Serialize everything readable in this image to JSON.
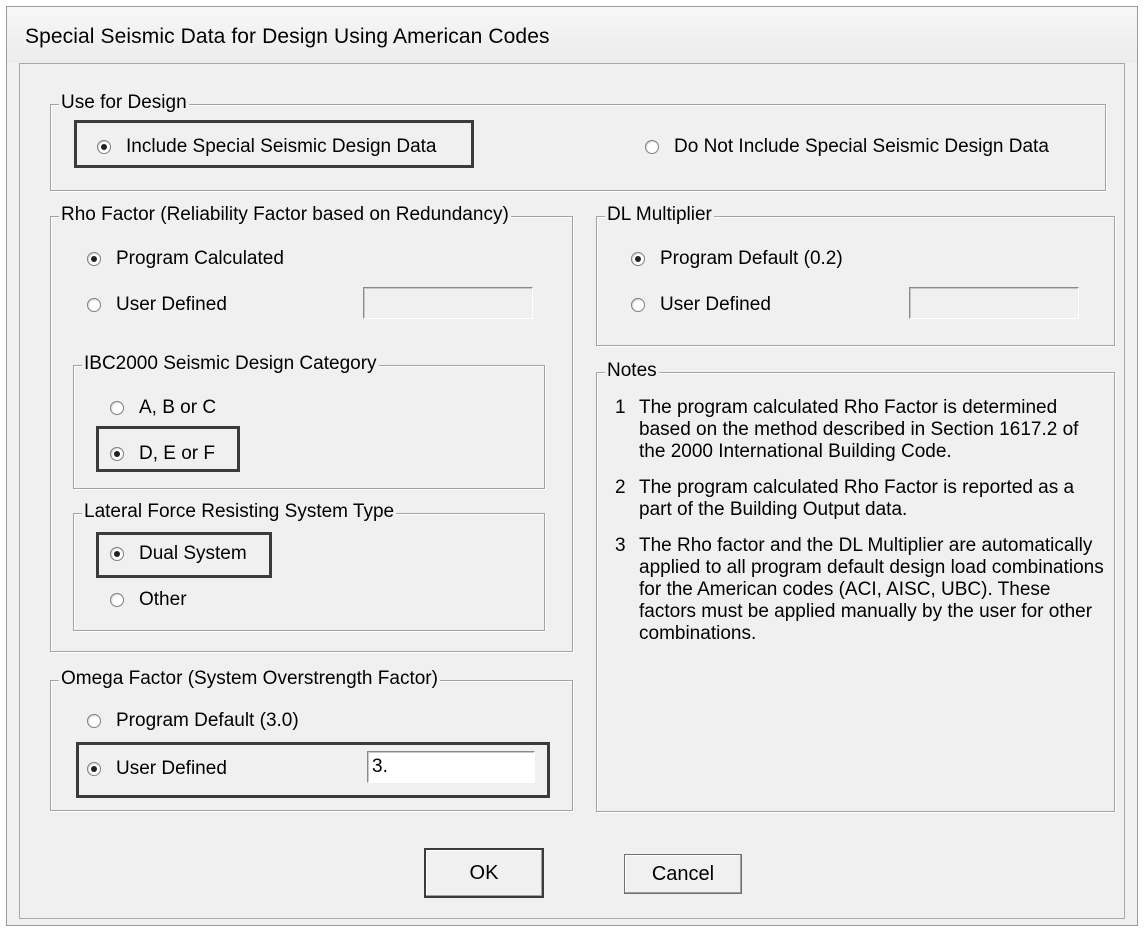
{
  "window": {
    "title": "Special Seismic Data for Design Using American Codes"
  },
  "use_for_design": {
    "legend": "Use for Design",
    "include_label": "Include Special Seismic Design Data",
    "exclude_label": "Do Not Include Special Seismic Design Data",
    "selected": "include"
  },
  "rho_factor": {
    "legend": "Rho Factor (Reliability Factor based on Redundancy)",
    "program_label": "Program Calculated",
    "user_label": "User Defined",
    "user_value": "",
    "selected": "program"
  },
  "ibc_category": {
    "legend": "IBC2000 Seismic Design Category",
    "abc_label": "A, B or C",
    "def_label": "D, E or F",
    "selected": "def"
  },
  "lateral_system": {
    "legend": "Lateral Force Resisting System Type",
    "dual_label": "Dual System",
    "other_label": "Other",
    "selected": "dual"
  },
  "omega_factor": {
    "legend": "Omega Factor (System Overstrength Factor)",
    "default_label": "Program Default (3.0)",
    "user_label": "User Defined",
    "user_value": "3.",
    "selected": "user"
  },
  "dl_multiplier": {
    "legend": "DL Multiplier",
    "default_label": "Program Default (0.2)",
    "user_label": "User Defined",
    "user_value": "",
    "selected": "default"
  },
  "notes": {
    "legend": "Notes",
    "items": [
      {
        "num": "1",
        "text": "The program calculated Rho Factor is determined based on the method described in Section 1617.2 of the 2000 International Building Code."
      },
      {
        "num": "2",
        "text": "The program calculated Rho Factor is reported as a part of the Building Output data."
      },
      {
        "num": "3",
        "text": "The Rho factor and the DL Multiplier are automatically applied to all program default design load combinations for the American codes (ACI, AISC, UBC).  These factors must be applied manually by the user for other combinations."
      }
    ]
  },
  "buttons": {
    "ok": "OK",
    "cancel": "Cancel"
  }
}
